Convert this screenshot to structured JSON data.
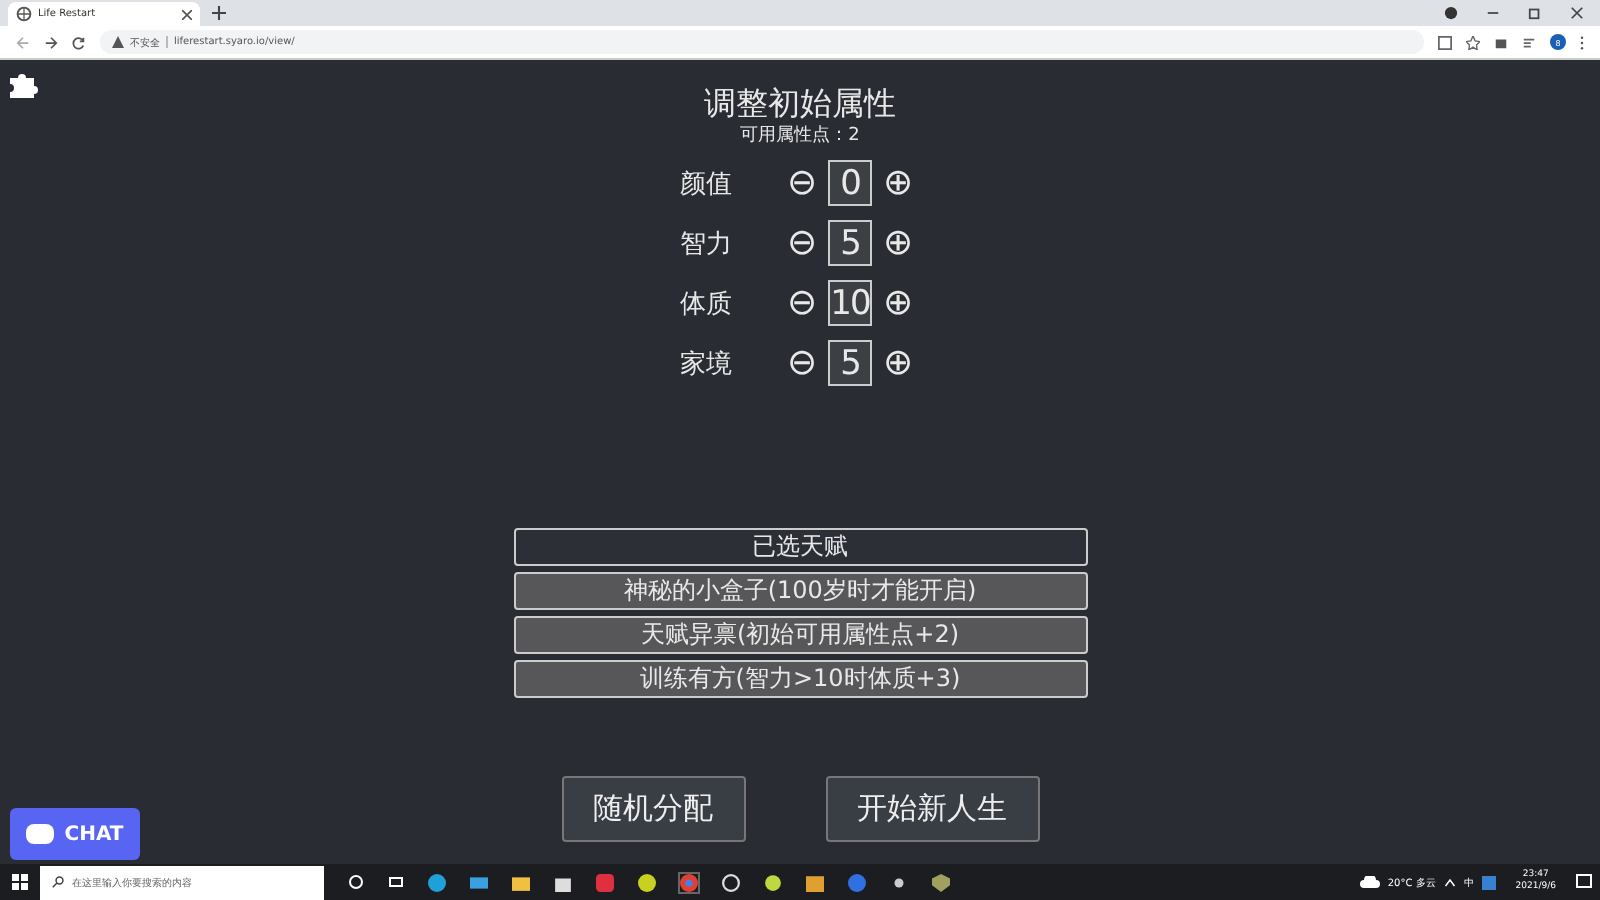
{
  "browser": {
    "tab_title": "Life Restart",
    "security": "不安全",
    "url": "liferestart.syaro.io/view/",
    "profile_initial": "8"
  },
  "page": {
    "title": "调整初始属性",
    "points": "可用属性点：2",
    "attributes": [
      {
        "name": "颜值",
        "minus": "⊖",
        "value": "0",
        "plus": "⊕"
      },
      {
        "name": "智力",
        "minus": "⊖",
        "value": "5",
        "plus": "⊕"
      },
      {
        "name": "体质",
        "minus": "⊖",
        "value": "10",
        "plus": "⊕"
      },
      {
        "name": "家境",
        "minus": "⊖",
        "value": "5",
        "plus": "⊕"
      }
    ],
    "talents_header": "已选天赋",
    "talents": [
      "神秘的小盒子(100岁时才能开启)",
      "天赋异禀(初始可用属性点+2)",
      "训练有方(智力>10时体质+3)"
    ],
    "buttons": [
      "随机分配",
      "开始新人生"
    ],
    "chat": "CHAT"
  },
  "taskbar": {
    "search_placeholder": "在这里输入你要搜索的内容",
    "weather": "20°C 多云",
    "ime": "中",
    "time": "23:47",
    "date": "2021/9/6"
  }
}
